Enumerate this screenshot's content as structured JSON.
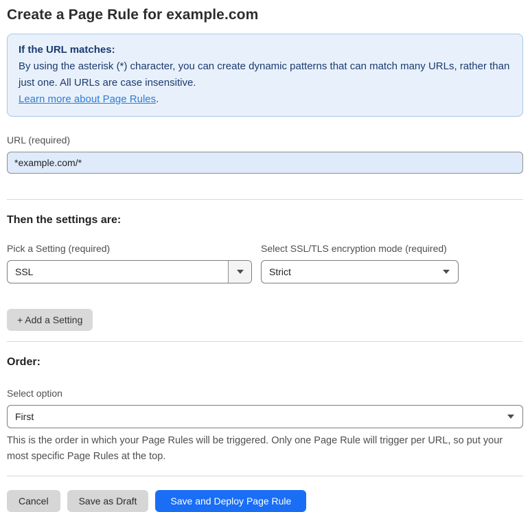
{
  "page": {
    "title": "Create a Page Rule for example.com"
  },
  "info_box": {
    "heading": "If the URL matches:",
    "body": "By using the asterisk (*) character, you can create dynamic patterns that can match many URLs, rather than just one. All URLs are case insensitive.",
    "link_label": "Learn more about Page Rules",
    "link_suffix": "."
  },
  "url_field": {
    "label": "URL (required)",
    "value": "*example.com/*"
  },
  "settings_section": {
    "heading": "Then the settings are:",
    "setting_picker": {
      "label": "Pick a Setting (required)",
      "value": "SSL"
    },
    "ssl_mode_picker": {
      "label": "Select SSL/TLS encryption mode (required)",
      "value": "Strict"
    },
    "add_setting_label": "+ Add a Setting"
  },
  "order_section": {
    "heading": "Order:",
    "select_label": "Select option",
    "selected_value": "First",
    "help_text": "This is the order in which your Page Rules will be triggered. Only one Page Rule will trigger per URL, so put your most specific Page Rules at the top."
  },
  "footer": {
    "cancel_label": "Cancel",
    "save_draft_label": "Save as Draft",
    "save_deploy_label": "Save and Deploy Page Rule"
  },
  "colors": {
    "accent_blue": "#1a6ef5",
    "info_box_bg": "#e8f1fb",
    "info_box_border": "#a6c7e8",
    "info_text_navy": "#1b3a6e",
    "link_blue": "#2f7bd3",
    "url_input_bg": "#dfeafa",
    "gray_button_bg": "#d6d6d6"
  },
  "icons": {
    "dropdown_arrow": "triangle-down"
  }
}
